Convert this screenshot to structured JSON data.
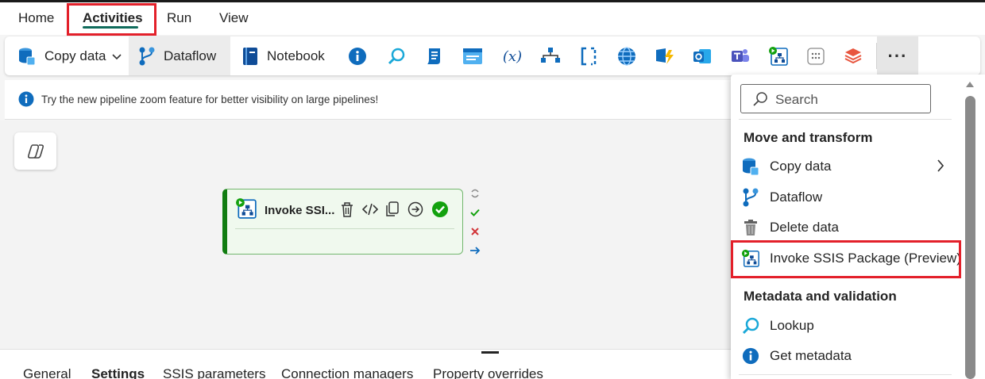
{
  "menu": {
    "tabs": [
      {
        "label": "Home"
      },
      {
        "label": "Activities"
      },
      {
        "label": "Run"
      },
      {
        "label": "View"
      }
    ]
  },
  "toolbar": {
    "copy_data": "Copy data",
    "dataflow": "Dataflow",
    "notebook": "Notebook",
    "icons": [
      "info-icon",
      "lookup-icon",
      "script-icon",
      "web-icon",
      "variable-icon",
      "pipeline-icon",
      "bracket-icon",
      "globe-icon",
      "azure-function-icon",
      "outlook-icon",
      "teams-icon",
      "ssis-icon",
      "grid-icon",
      "stack-icon"
    ],
    "more": "···"
  },
  "info_banner": {
    "text": "Try the new pipeline zoom feature for better visibility on large pipelines!"
  },
  "node": {
    "title": "Invoke SSI..."
  },
  "bottom_tabs": [
    {
      "label": "General"
    },
    {
      "label": "Settings"
    },
    {
      "label": "SSIS parameters"
    },
    {
      "label": "Connection managers"
    },
    {
      "label": "Property overrides"
    }
  ],
  "dropdown": {
    "search_placeholder": "Search",
    "sections": [
      {
        "title": "Move and transform",
        "items": [
          {
            "label": "Copy data"
          },
          {
            "label": "Dataflow"
          },
          {
            "label": "Delete data"
          },
          {
            "label": "Invoke SSIS Package (Preview)"
          }
        ]
      },
      {
        "title": "Metadata and validation",
        "items": [
          {
            "label": "Lookup"
          },
          {
            "label": "Get metadata"
          }
        ]
      }
    ]
  },
  "colors": {
    "accent_green": "#107c10",
    "highlight_red": "#e3202a",
    "info_blue": "#0f6cbd",
    "tab_underline": "#0f6b5b"
  }
}
